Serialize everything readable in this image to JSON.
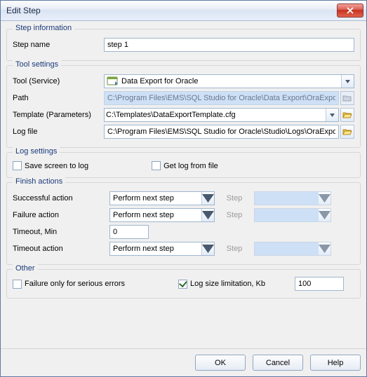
{
  "window": {
    "title": "Edit Step"
  },
  "step_info": {
    "legend": "Step information",
    "name_label": "Step name",
    "name_value": "step 1"
  },
  "tool_settings": {
    "legend": "Tool settings",
    "tool_label": "Tool (Service)",
    "tool_selected": "Data Export for Oracle",
    "path_label": "Path",
    "path_value": "C:\\Program Files\\EMS\\SQL Studio for Oracle\\Data Export\\OraExpo",
    "template_label": "Template (Parameters)",
    "template_value": "C:\\Templates\\DataExportTemplate.cfg",
    "logfile_label": "Log file",
    "logfile_value": "C:\\Program Files\\EMS\\SQL Studio for Oracle\\Studio\\Logs\\OraExpo"
  },
  "log_settings": {
    "legend": "Log settings",
    "save_screen_label": "Save screen to log",
    "save_screen_checked": false,
    "get_log_label": "Get log from file",
    "get_log_checked": false
  },
  "finish_actions": {
    "legend": "Finish actions",
    "success_label": "Successful action",
    "success_value": "Perform next step",
    "failure_label": "Failure action",
    "failure_value": "Perform next step",
    "timeout_min_label": "Timeout, Min",
    "timeout_min_value": "0",
    "timeout_action_label": "Timeout action",
    "timeout_action_value": "Perform next step",
    "step_label": "Step"
  },
  "other": {
    "legend": "Other",
    "failure_only_label": "Failure only for serious errors",
    "failure_only_checked": false,
    "log_size_label": "Log size limitation, Kb",
    "log_size_checked": true,
    "log_size_value": "100"
  },
  "buttons": {
    "ok": "OK",
    "cancel": "Cancel",
    "help": "Help"
  }
}
